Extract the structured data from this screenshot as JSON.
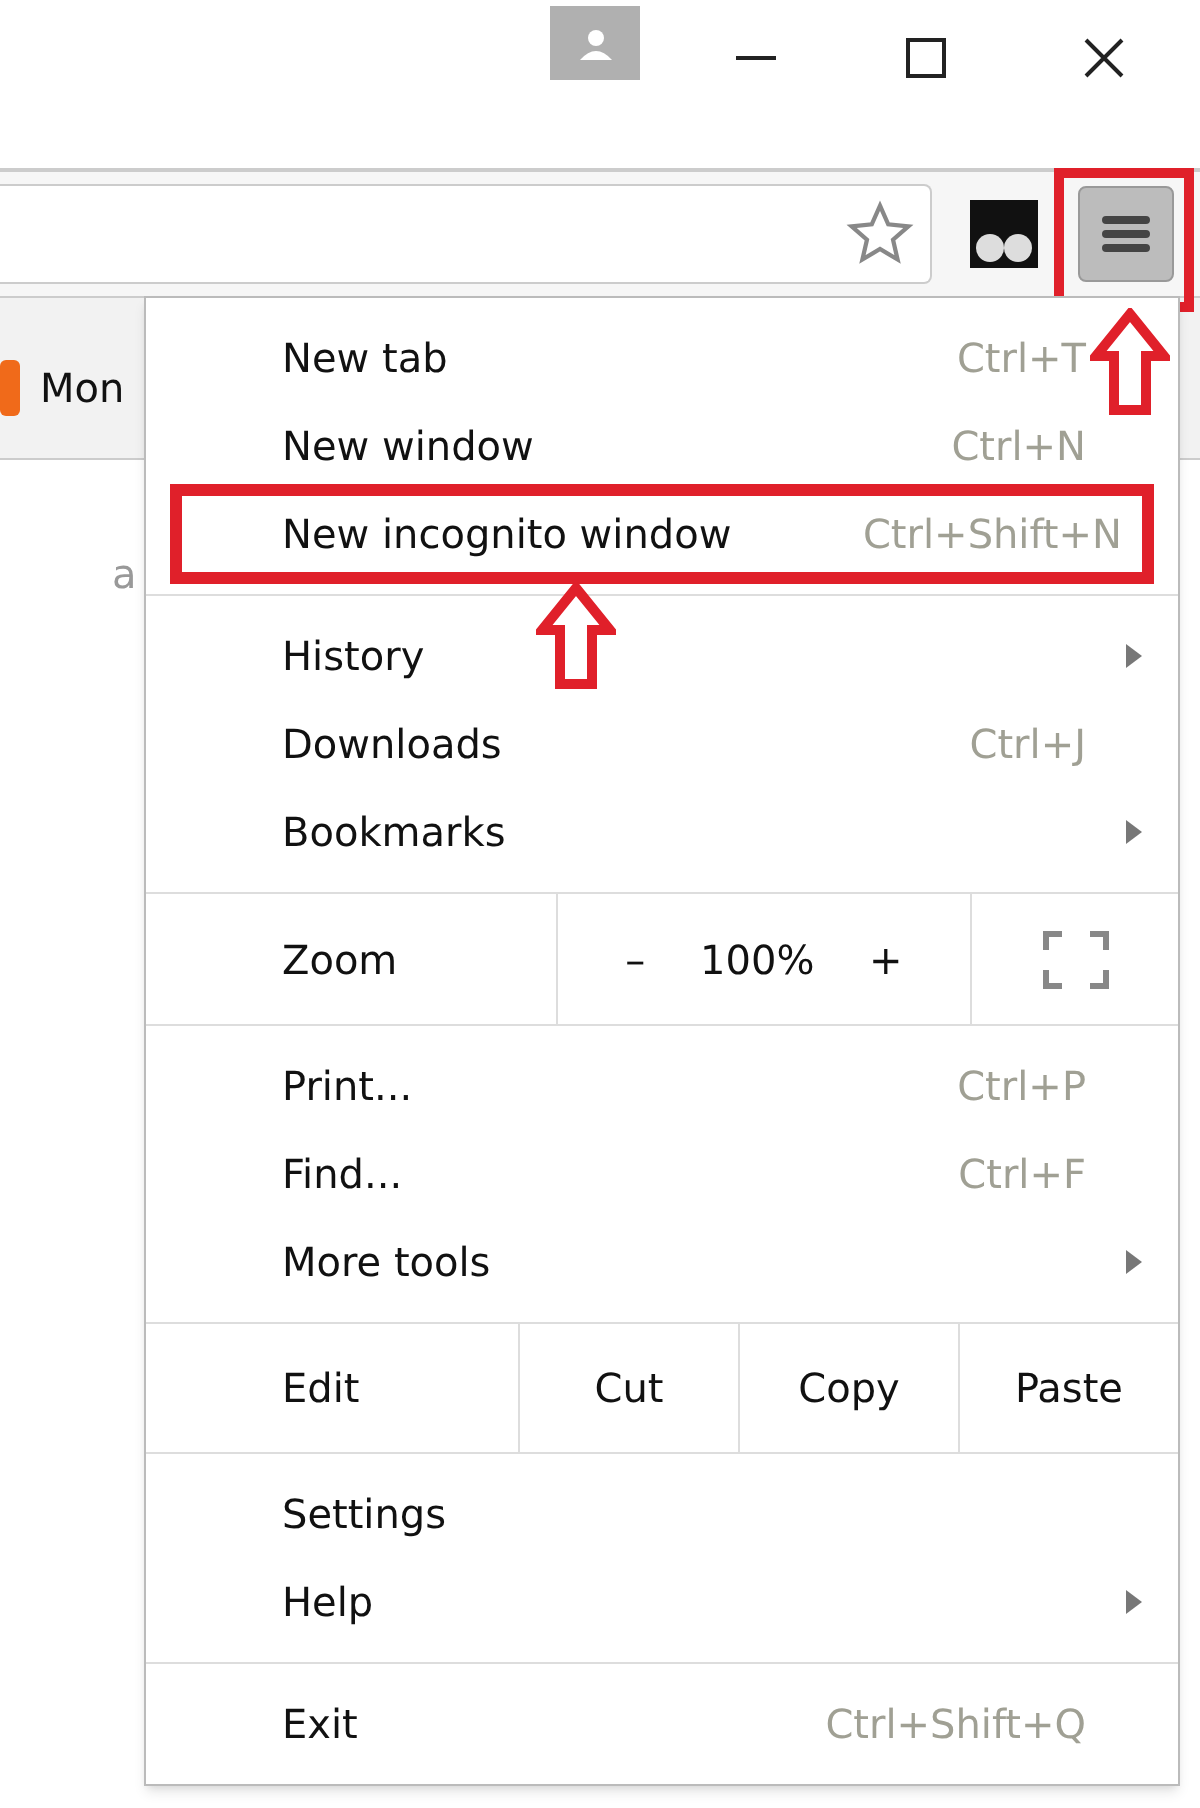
{
  "bookmarks_bar": {
    "items": [
      {
        "label": "Mon"
      }
    ]
  },
  "page": {
    "text": "a"
  },
  "menu_button": {
    "highlighted": true
  },
  "menu": {
    "sections": [
      {
        "kind": "items",
        "items": [
          {
            "label": "New tab",
            "shortcut": "Ctrl+T",
            "submenu": false,
            "highlighted": false
          },
          {
            "label": "New window",
            "shortcut": "Ctrl+N",
            "submenu": false,
            "highlighted": false
          },
          {
            "label": "New incognito window",
            "shortcut": "Ctrl+Shift+N",
            "submenu": false,
            "highlighted": true
          }
        ]
      },
      {
        "kind": "items",
        "items": [
          {
            "label": "History",
            "submenu": true,
            "highlighted": false
          },
          {
            "label": "Downloads",
            "shortcut": "Ctrl+J",
            "submenu": false,
            "highlighted": false
          },
          {
            "label": "Bookmarks",
            "submenu": true,
            "highlighted": false
          }
        ]
      },
      {
        "kind": "zoom",
        "label": "Zoom",
        "minus": "–",
        "value": "100%",
        "plus": "+"
      },
      {
        "kind": "items",
        "items": [
          {
            "label": "Print...",
            "shortcut": "Ctrl+P",
            "submenu": false,
            "highlighted": false
          },
          {
            "label": "Find...",
            "shortcut": "Ctrl+F",
            "submenu": false,
            "highlighted": false
          },
          {
            "label": "More tools",
            "submenu": true,
            "highlighted": false
          }
        ]
      },
      {
        "kind": "edit",
        "label": "Edit",
        "buttons": [
          "Cut",
          "Copy",
          "Paste"
        ]
      },
      {
        "kind": "items",
        "items": [
          {
            "label": "Settings",
            "submenu": false,
            "highlighted": false
          },
          {
            "label": "Help",
            "submenu": true,
            "highlighted": false
          }
        ]
      },
      {
        "kind": "items",
        "items": [
          {
            "label": "Exit",
            "shortcut": "Ctrl+Shift+Q",
            "submenu": false,
            "highlighted": false
          }
        ]
      }
    ]
  }
}
